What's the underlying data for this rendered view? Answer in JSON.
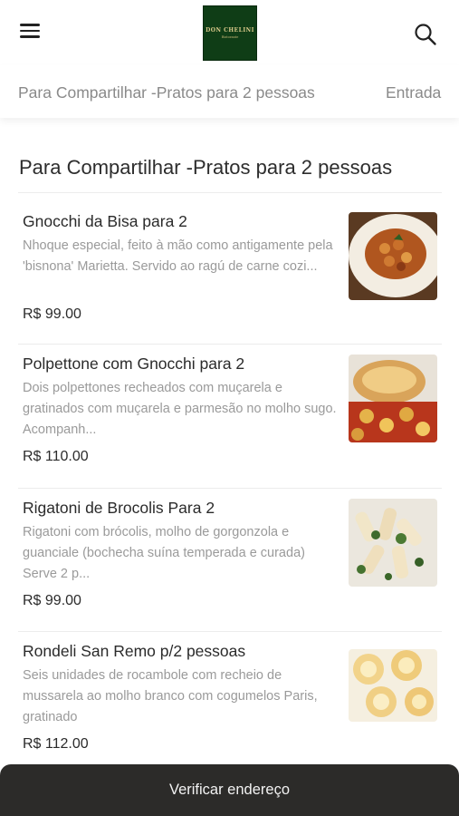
{
  "header": {
    "logo_text": "DON CHELINI",
    "logo_sub": "Ristorante"
  },
  "tabs": [
    {
      "label": "Para Compartilhar -Pratos para 2 pessoas"
    },
    {
      "label": "Entrada"
    }
  ],
  "section": {
    "title": "Para Compartilhar -Pratos para 2 pessoas"
  },
  "items": [
    {
      "name": "Gnocchi da Bisa para 2",
      "description": "Nhoque especial, feito à mão como antigamente pela 'bisnona' Marietta. Servido ao ragú de carne cozi...",
      "price": "R$ 99.00",
      "image": "gnocchi-ragu-plate"
    },
    {
      "name": "Polpettone com Gnocchi para 2",
      "description": "Dois polpettones recheados com muçarela e gratinados com muçarela e parmesão no molho sugo. Acompanh...",
      "price": "R$ 110.00",
      "image": "polpettone-gnocchi-plate"
    },
    {
      "name": "Rigatoni de Brocolis Para 2",
      "description": "Rigatoni com brócolis, molho de gorgonzola e guanciale (bochecha suína temperada e curada) Serve 2 p...",
      "price": "R$ 99.00",
      "image": "rigatoni-broccoli-plate"
    },
    {
      "name": "Rondeli San Remo p/2 pessoas",
      "description": "Seis unidades de rocambole com recheio de mussarela ao molho branco com cogumelos Paris, gratinado",
      "price": "R$ 112.00",
      "image": "rondelli-plate"
    }
  ],
  "footer": {
    "label": "Verificar endereço"
  }
}
